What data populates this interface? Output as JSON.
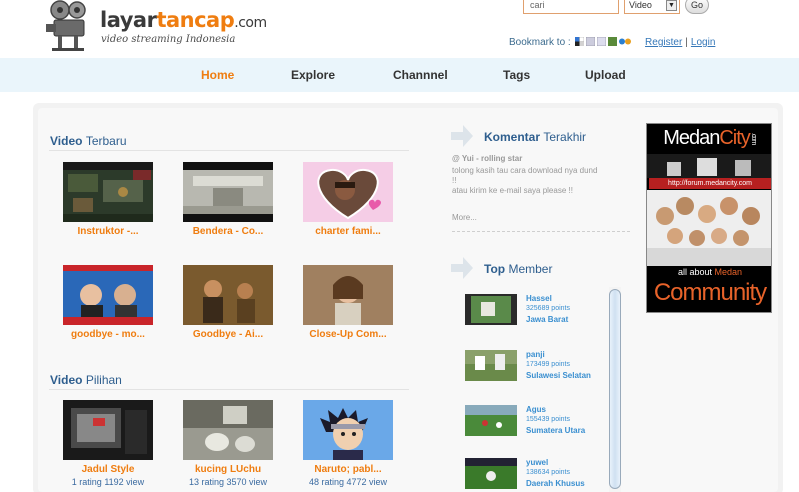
{
  "header": {
    "logo_part1": "layar",
    "logo_part2": "tancap",
    "logo_part3": ".com",
    "tagline": "video streaming Indonesia",
    "search_placeholder": "cari",
    "search_type_value": "Video",
    "go_label": "Go",
    "bookmark_label": "Bookmark to :",
    "register_label": "Register",
    "login_label": "Login",
    "separator": "|"
  },
  "nav": {
    "items": [
      {
        "label": "Home",
        "active": true
      },
      {
        "label": "Explore",
        "active": false
      },
      {
        "label": "Channnel",
        "active": false
      },
      {
        "label": "Tags",
        "active": false
      },
      {
        "label": "Upload",
        "active": false
      }
    ]
  },
  "latest_videos": {
    "title_bold": "Video",
    "title_rest": "Terbaru",
    "items": [
      {
        "title": "Instruktor -..."
      },
      {
        "title": "Bendera - Co..."
      },
      {
        "title": "charter fami..."
      },
      {
        "title": "goodbye - mo..."
      },
      {
        "title": "Goodbye - Ai..."
      },
      {
        "title": "Close-Up Com..."
      }
    ]
  },
  "featured_videos": {
    "title_bold": "Video",
    "title_rest": "Pilihan",
    "items": [
      {
        "title": "Jadul Style",
        "meta": "1 rating 1192 view"
      },
      {
        "title": "kucing LUchu",
        "meta": "13 rating 3570 view"
      },
      {
        "title": "Naruto; pabl...",
        "meta": "48 rating 4772 view"
      }
    ]
  },
  "comments": {
    "title_bold": "Komentar",
    "title_rest": "Terakhir",
    "user_line": "@ Yui - rolling star",
    "text_line1": "tolong kasih tau cara download nya dund",
    "text_line2": "!!",
    "text_line3": "atau kirim ke e-mail saya please !!",
    "more_label": "More..."
  },
  "top_members": {
    "title_bold": "Top",
    "title_rest": "Member",
    "items": [
      {
        "name": "Hassel",
        "points": "325689 points",
        "location": "Jawa Barat"
      },
      {
        "name": "panji",
        "points": "173499 points",
        "location": "Sulawesi Selatan"
      },
      {
        "name": "Agus",
        "points": "155439 points",
        "location": "Sumatera Utara"
      },
      {
        "name": "yuwel",
        "points": "138634 points",
        "location": "Daerah Khusus"
      }
    ]
  },
  "ad": {
    "brand_part1": "Medan",
    "brand_part2": "City",
    "brand_suffix": ".com",
    "url": "http://forum.medancity.com",
    "about_part1": "all about",
    "about_part2": "Medan",
    "community": "Community"
  },
  "colors": {
    "accent_orange": "#ef7d10",
    "title_blue": "#2e5e8e",
    "link_blue": "#3577b8",
    "nav_bg": "#eaf5fb"
  }
}
